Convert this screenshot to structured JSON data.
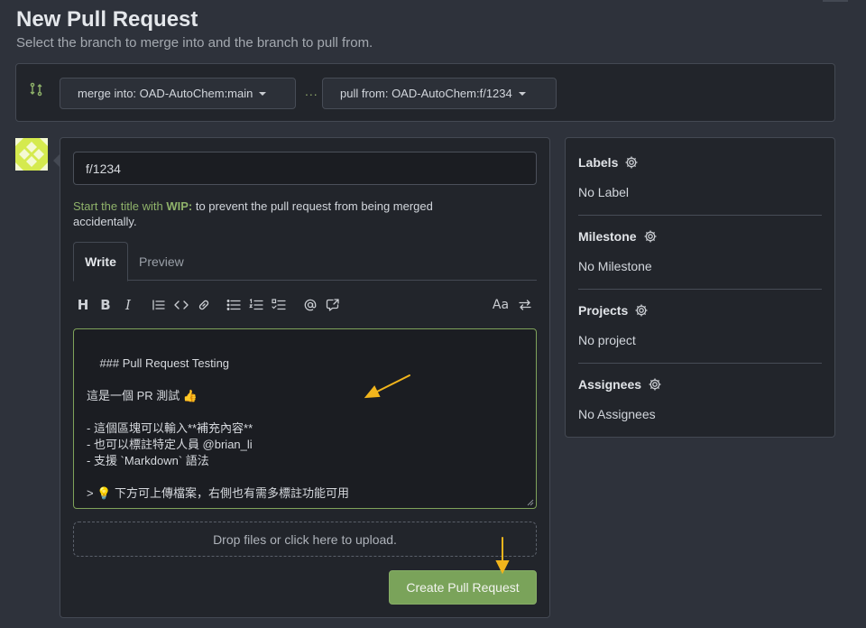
{
  "header": {
    "title": "New Pull Request",
    "subtitle": "Select the branch to merge into and the branch to pull from."
  },
  "branches": {
    "merge_into": "merge into: OAD-AutoChem:main",
    "separator": "...",
    "pull_from": "pull from: OAD-AutoChem:f/1234"
  },
  "form": {
    "title_value": "f/1234",
    "wip_prefix": "Start the title with ",
    "wip_keyword": "WIP:",
    "wip_suffix": " to prevent the pull request from being merged accidentally.",
    "tabs": {
      "write": "Write",
      "preview": "Preview"
    },
    "toolbar": {
      "heading": "H",
      "bold": "B",
      "italic": "I",
      "text_size": "Aa"
    },
    "body": "### Pull Request Testing\n\n這是一個 PR 測試 👍\n\n- 這個區塊可以輸入**補充內容**\n- 也可以標註特定人員 @brian_li\n- 支援 `Markdown` 語法\n\n> 💡 下方可上傳檔案，右側也有需多標註功能可用",
    "dropzone": "Drop files or click here to upload.",
    "submit_label": "Create Pull Request"
  },
  "sidebar": {
    "labels": {
      "heading": "Labels",
      "value": "No Label"
    },
    "milestone": {
      "heading": "Milestone",
      "value": "No Milestone"
    },
    "projects": {
      "heading": "Projects",
      "value": "No project"
    },
    "assignees": {
      "heading": "Assignees",
      "value": "No Assignees"
    }
  },
  "colors": {
    "accent_green": "#7aa35a",
    "annotation_arrow": "#f2b51c",
    "background": "#2e323b",
    "panel": "#22252b"
  },
  "icons": [
    "git-compare-icon",
    "caret-down-icon",
    "gear-icon",
    "link-icon",
    "code-icon",
    "quote-icon",
    "bullet-list-icon",
    "numbered-list-icon",
    "task-list-icon",
    "mention-icon",
    "cross-reference-icon",
    "switch-editor-icon"
  ]
}
